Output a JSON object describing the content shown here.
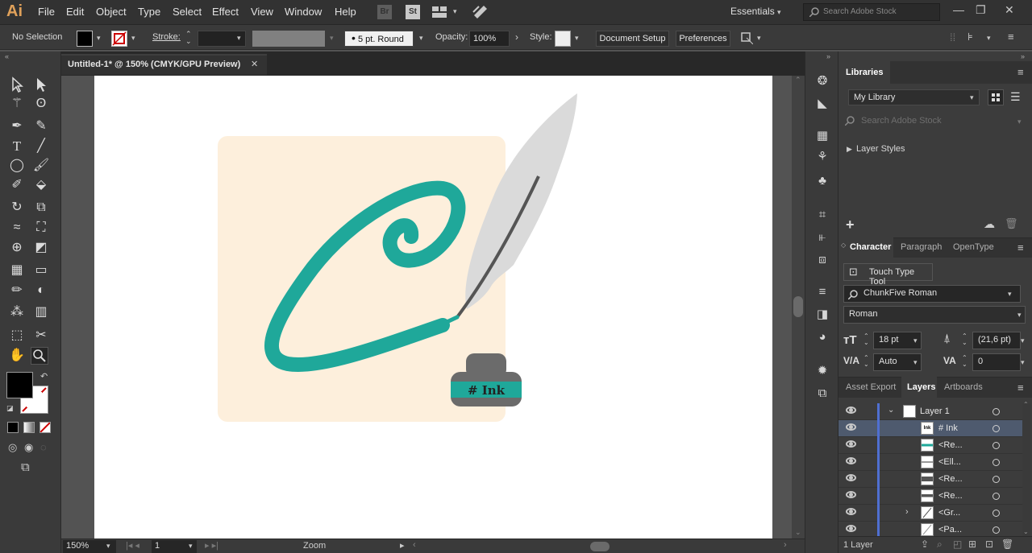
{
  "menubar": {
    "logo": "Ai",
    "items": [
      "File",
      "Edit",
      "Object",
      "Type",
      "Select",
      "Effect",
      "View",
      "Window",
      "Help"
    ],
    "bridge_icon": "Br",
    "stock_icon": "St",
    "workspace": "Essentials",
    "search_placeholder": "Search Adobe Stock"
  },
  "controlbar": {
    "selection": "No Selection",
    "stroke_label": "Stroke:",
    "brush": "5 pt. Round",
    "opacity_label": "Opacity:",
    "opacity_value": "100%",
    "style_label": "Style:",
    "document_setup": "Document Setup",
    "preferences": "Preferences"
  },
  "document": {
    "tab_title": "Untitled-1* @ 150% (CMYK/GPU Preview)",
    "ink_label": "# Ink"
  },
  "status": {
    "zoom": "150%",
    "artboard": "1",
    "tool": "Zoom"
  },
  "libraries": {
    "title": "Libraries",
    "library": "My Library",
    "search_placeholder": "Search Adobe Stock",
    "section": "Layer Styles"
  },
  "character": {
    "tabs": [
      "Character",
      "Paragraph",
      "OpenType"
    ],
    "touch_type": "Touch Type Tool",
    "font_family": "ChunkFive Roman",
    "font_style": "Roman",
    "font_size": "18 pt",
    "leading": "(21,6 pt)",
    "kerning": "Auto",
    "tracking": "0"
  },
  "layers": {
    "tabs": [
      "Asset Export",
      "Layers",
      "Artboards"
    ],
    "rows": [
      {
        "name": "Layer 1"
      },
      {
        "name": "# Ink"
      },
      {
        "name": "<Re..."
      },
      {
        "name": "<Ell..."
      },
      {
        "name": "<Re..."
      },
      {
        "name": "<Re..."
      },
      {
        "name": "<Gr..."
      },
      {
        "name": "<Pa..."
      }
    ],
    "count": "1 Layer"
  },
  "colors": {
    "teal": "#1fa89a",
    "cream": "#fdefdc",
    "feather": "#dadada",
    "ink_bottle": "#6b6b6b",
    "accent_blue": "#4f6fd1"
  }
}
